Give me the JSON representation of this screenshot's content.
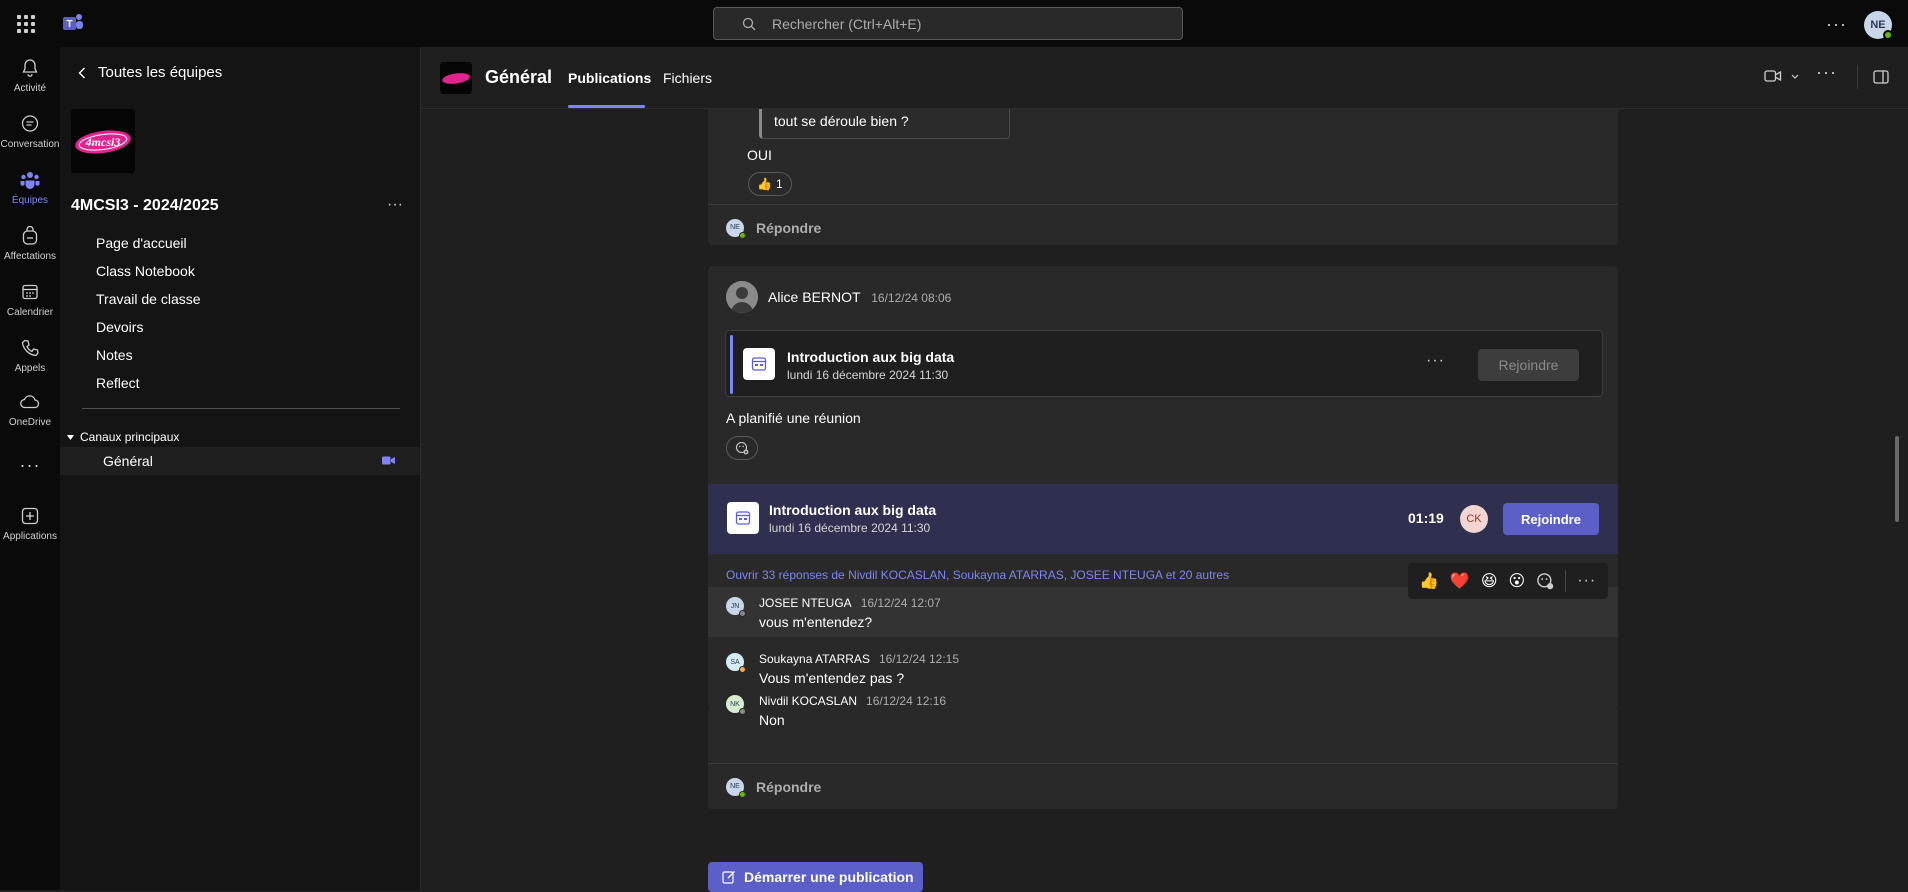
{
  "search": {
    "placeholder": "Rechercher (Ctrl+Alt+E)"
  },
  "user": {
    "initials": "NE"
  },
  "rail": [
    {
      "label": "Activité",
      "icon": "bell-icon"
    },
    {
      "label": "Conversation",
      "icon": "chat-icon"
    },
    {
      "label": "Équipes",
      "icon": "teams-icon"
    },
    {
      "label": "Affectations",
      "icon": "backpack-icon"
    },
    {
      "label": "Calendrier",
      "icon": "calendar-icon"
    },
    {
      "label": "Appels",
      "icon": "phone-icon"
    },
    {
      "label": "OneDrive",
      "icon": "cloud-icon"
    },
    {
      "label": "Applications",
      "icon": "add-app-icon"
    }
  ],
  "sidebar": {
    "back_label": "Toutes les équipes",
    "team_name": "4MCSI3 - 2024/2025",
    "logo_text": "4mcsi3",
    "items": [
      "Page d'accueil",
      "Class Notebook",
      "Travail de classe",
      "Devoirs",
      "Notes",
      "Reflect"
    ],
    "channels_header": "Canaux principaux",
    "channel": "Général"
  },
  "header": {
    "title": "Général",
    "tabs": [
      "Publications",
      "Fichiers"
    ]
  },
  "thread1": {
    "quote": "tout se déroule bien ?",
    "reply_text": "OUI",
    "reaction_count": "1",
    "reply_label": "Répondre",
    "reply_avatar": "NE"
  },
  "thread2": {
    "author": "Alice BERNOT",
    "timestamp": "16/12/24 08:06",
    "meeting_title": "Introduction aux big data",
    "meeting_date": "lundi 16 décembre 2024 11:30",
    "join_label": "Rejoindre",
    "message": "A planifié une réunion",
    "live_timer": "01:19",
    "live_attendee": "CK",
    "open_replies": "Ouvrir 33 réponses de Nivdil KOCASLAN, Soukayna ATARRAS, JOSEE NTEUGA et 20 autres",
    "replies": [
      {
        "initials": "JN",
        "name": "JOSEE NTEUGA",
        "time": "16/12/24 12:07",
        "text": "vous m'entendez?"
      },
      {
        "initials": "SA",
        "name": "Soukayna ATARRAS",
        "time": "16/12/24 12:15",
        "text": "Vous m'entendez pas ?"
      },
      {
        "initials": "NK",
        "name": "Nivdil KOCASLAN",
        "time": "16/12/24 12:16",
        "text": "Non"
      }
    ],
    "reply_label": "Répondre",
    "reply_avatar": "NE"
  },
  "reactions": [
    "👍",
    "❤️",
    "😆",
    "😮"
  ],
  "post_button": "Démarrer une publication",
  "colors": {
    "accent": "#5b5fc7",
    "accent_light": "#7f85f5",
    "presence": "#6bb700"
  }
}
